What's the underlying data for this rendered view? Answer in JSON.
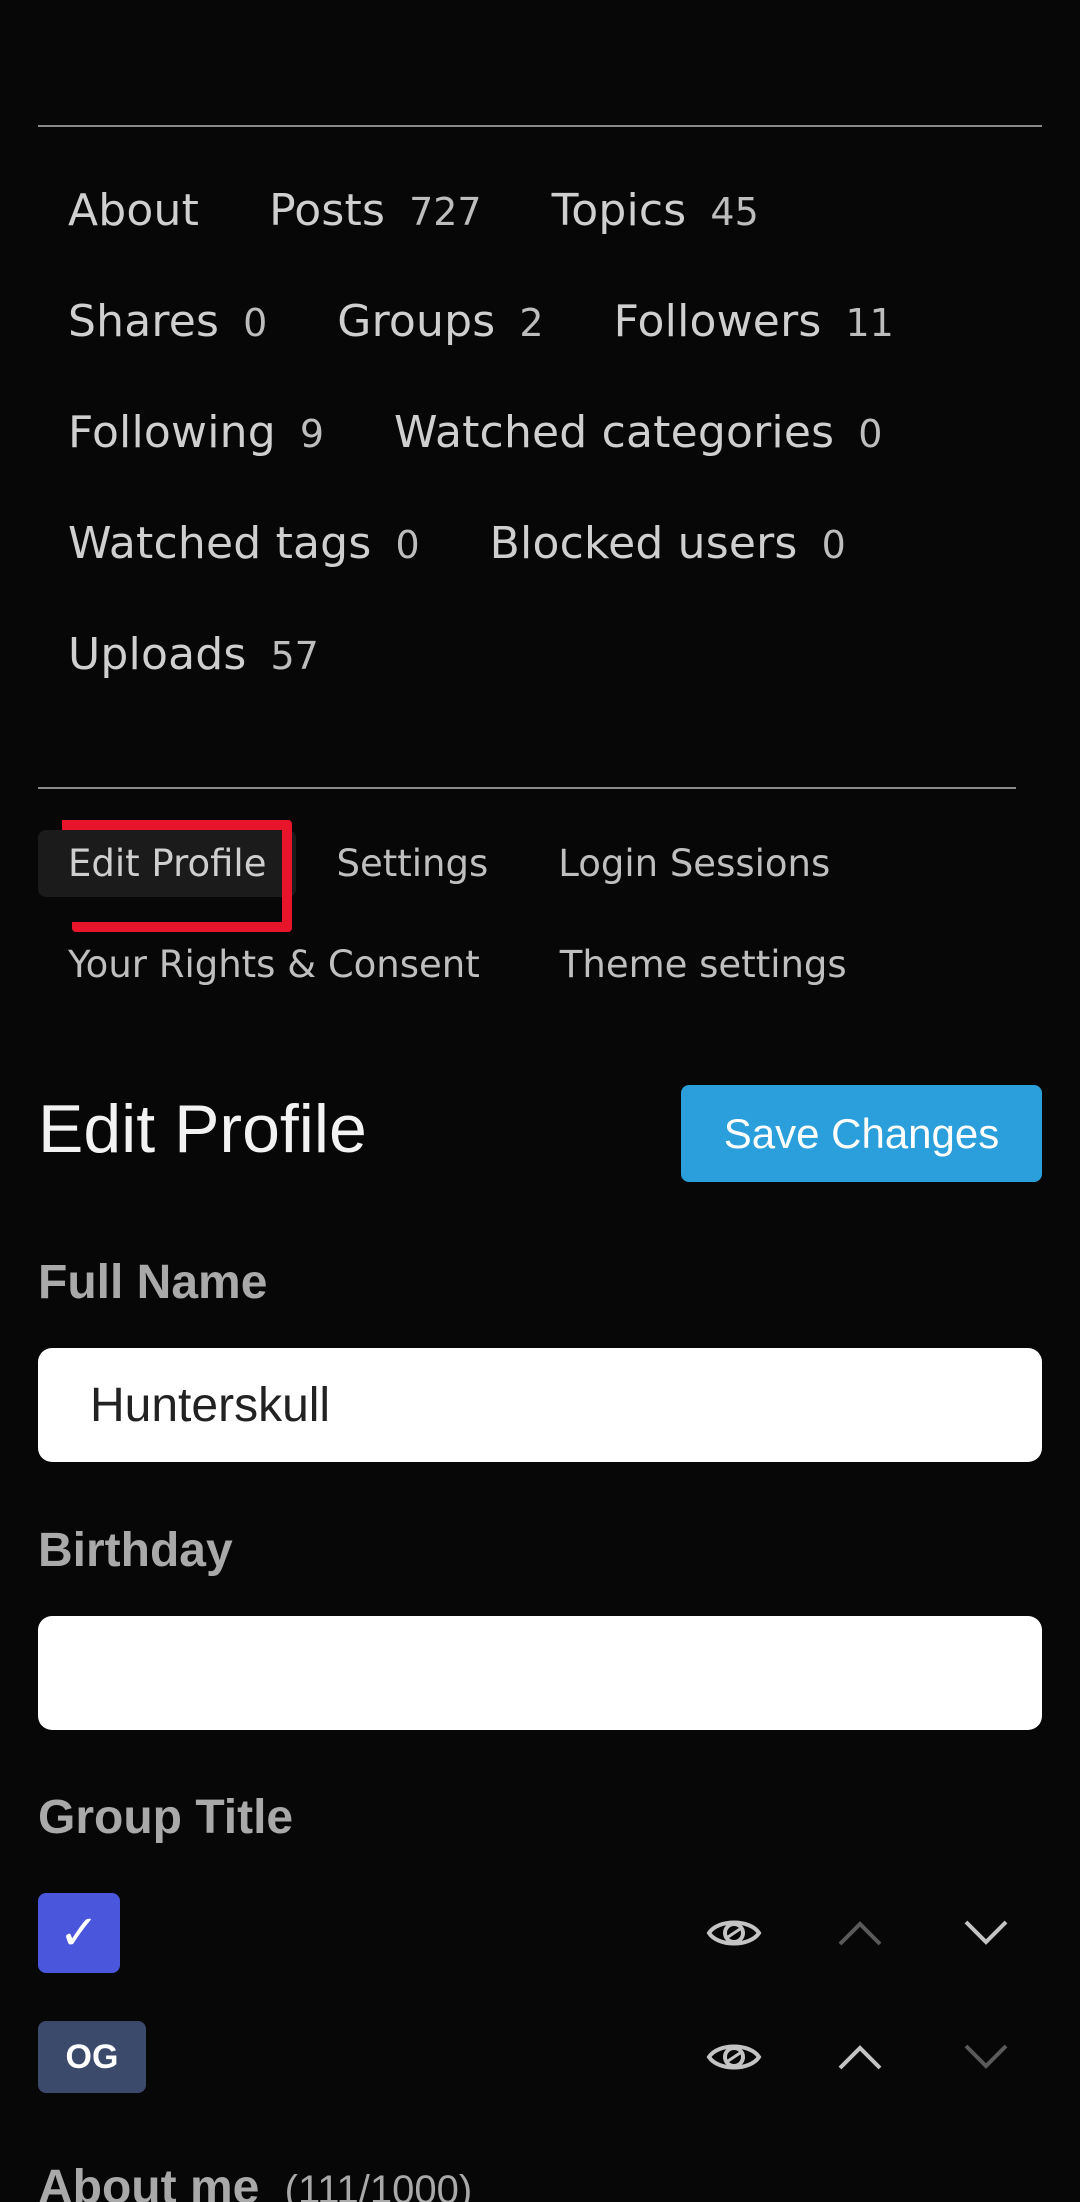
{
  "profile_nav": {
    "rows": [
      [
        {
          "label": "About",
          "count": ""
        },
        {
          "label": "Posts",
          "count": "727"
        },
        {
          "label": "Topics",
          "count": "45"
        }
      ],
      [
        {
          "label": "Shares",
          "count": "0"
        },
        {
          "label": "Groups",
          "count": "2"
        },
        {
          "label": "Followers",
          "count": "11"
        }
      ],
      [
        {
          "label": "Following",
          "count": "9"
        },
        {
          "label": "Watched categories",
          "count": "0"
        }
      ],
      [
        {
          "label": "Watched tags",
          "count": "0"
        },
        {
          "label": "Blocked users",
          "count": "0"
        }
      ],
      [
        {
          "label": "Uploads",
          "count": "57"
        }
      ]
    ]
  },
  "sub_nav": {
    "edit_profile": "Edit Profile",
    "settings": "Settings",
    "login_sessions": "Login Sessions",
    "rights_consent": "Your Rights & Consent",
    "theme_settings": "Theme settings"
  },
  "edit_profile": {
    "title": "Edit Profile",
    "save_label": "Save Changes",
    "full_name_label": "Full Name",
    "full_name_value": "Hunterskull",
    "birthday_label": "Birthday",
    "birthday_value": "",
    "group_title_label": "Group Title",
    "groups": [
      {
        "badge": "✓",
        "icon": "checkmark-icon"
      },
      {
        "badge": "OG",
        "icon": ""
      }
    ],
    "about_label": "About me",
    "about_count": "(111/1000)"
  },
  "colors": {
    "background": "#070707",
    "accent": "#2a9fdb",
    "highlight": "#e8142a",
    "badge_check": "#4a56dc",
    "badge_og": "#3b4a6b"
  }
}
